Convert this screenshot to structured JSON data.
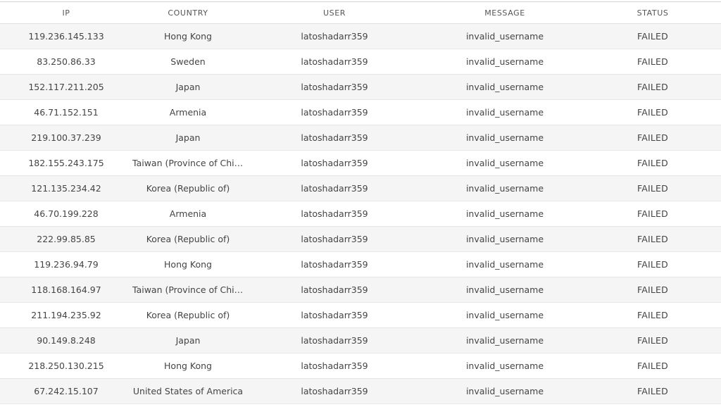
{
  "table": {
    "columns": [
      "IP",
      "COUNTRY",
      "USER",
      "MESSAGE",
      "STATUS"
    ],
    "rows": [
      {
        "ip": "119.236.145.133",
        "country": "Hong Kong",
        "user": "latoshadarr359",
        "message": "invalid_username",
        "status": "FAILED"
      },
      {
        "ip": "83.250.86.33",
        "country": "Sweden",
        "user": "latoshadarr359",
        "message": "invalid_username",
        "status": "FAILED"
      },
      {
        "ip": "152.117.211.205",
        "country": "Japan",
        "user": "latoshadarr359",
        "message": "invalid_username",
        "status": "FAILED"
      },
      {
        "ip": "46.71.152.151",
        "country": "Armenia",
        "user": "latoshadarr359",
        "message": "invalid_username",
        "status": "FAILED"
      },
      {
        "ip": "219.100.37.239",
        "country": "Japan",
        "user": "latoshadarr359",
        "message": "invalid_username",
        "status": "FAILED"
      },
      {
        "ip": "182.155.243.175",
        "country": "Taiwan (Province of China)",
        "user": "latoshadarr359",
        "message": "invalid_username",
        "status": "FAILED"
      },
      {
        "ip": "121.135.234.42",
        "country": "Korea (Republic of)",
        "user": "latoshadarr359",
        "message": "invalid_username",
        "status": "FAILED"
      },
      {
        "ip": "46.70.199.228",
        "country": "Armenia",
        "user": "latoshadarr359",
        "message": "invalid_username",
        "status": "FAILED"
      },
      {
        "ip": "222.99.85.85",
        "country": "Korea (Republic of)",
        "user": "latoshadarr359",
        "message": "invalid_username",
        "status": "FAILED"
      },
      {
        "ip": "119.236.94.79",
        "country": "Hong Kong",
        "user": "latoshadarr359",
        "message": "invalid_username",
        "status": "FAILED"
      },
      {
        "ip": "118.168.164.97",
        "country": "Taiwan (Province of China)",
        "user": "latoshadarr359",
        "message": "invalid_username",
        "status": "FAILED"
      },
      {
        "ip": "211.194.235.92",
        "country": "Korea (Republic of)",
        "user": "latoshadarr359",
        "message": "invalid_username",
        "status": "FAILED"
      },
      {
        "ip": "90.149.8.248",
        "country": "Japan",
        "user": "latoshadarr359",
        "message": "invalid_username",
        "status": "FAILED"
      },
      {
        "ip": "218.250.130.215",
        "country": "Hong Kong",
        "user": "latoshadarr359",
        "message": "invalid_username",
        "status": "FAILED"
      },
      {
        "ip": "67.242.15.107",
        "country": "United States of America",
        "user": "latoshadarr359",
        "message": "invalid_username",
        "status": "FAILED"
      }
    ]
  }
}
